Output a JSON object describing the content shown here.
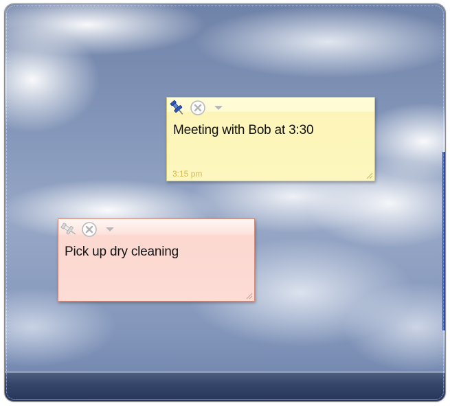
{
  "window": {
    "description": "Sticky notes on desktop"
  },
  "colors": {
    "yellow_note": "#fdf6be",
    "pink_note": "#fcdcd5",
    "taskbar": "#36466a",
    "timestamp": "#d6b94a"
  },
  "notes": [
    {
      "color": "yellow",
      "text": "Meeting with Bob at 3:30",
      "time": "3:15 pm",
      "pin_state": "pinned",
      "icons": [
        "pushpin-icon",
        "close-circle-icon",
        "dropdown-arrow-icon"
      ]
    },
    {
      "color": "pink",
      "text": "Pick up dry cleaning",
      "pin_state": "unpinned",
      "icons": [
        "pushpin-icon",
        "close-circle-icon",
        "dropdown-arrow-icon"
      ]
    }
  ]
}
